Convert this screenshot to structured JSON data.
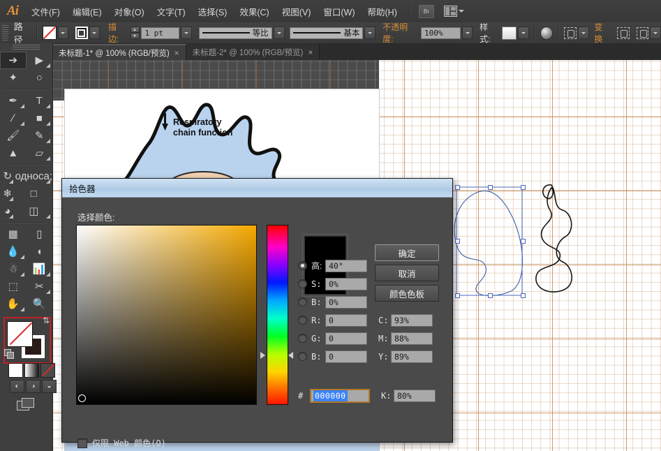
{
  "app": {
    "name": "Ai",
    "logo_color": "#e8913a"
  },
  "menubar": {
    "items": [
      "文件(F)",
      "编辑(E)",
      "对象(O)",
      "文字(T)",
      "选择(S)",
      "效果(C)",
      "视图(V)",
      "窗口(W)",
      "帮助(H)"
    ],
    "bridge_label": "Br"
  },
  "controlbar": {
    "object_label": "路径",
    "stroke_label": "描边:",
    "stroke_weight": "1 pt",
    "profile_label": "等比",
    "brush_label": "基本",
    "opacity_label": "不透明度:",
    "opacity_value": "100%",
    "style_label": "样式:",
    "transform_label": "变换"
  },
  "tabs": [
    {
      "title": "未标题-1* @ 100% (RGB/预览)",
      "close": "×",
      "active": true
    },
    {
      "title": "未标题-2* @ 100% (RGB/预览)",
      "close": "×",
      "active": false
    }
  ],
  "toolbar": {
    "tools": [
      "selection-tool",
      "direct-selection-tool",
      "magic-wand-tool",
      "lasso-tool",
      "pen-tool",
      "type-tool",
      "line-segment-tool",
      "rectangle-tool",
      "paintbrush-tool",
      "pencil-tool",
      "blob-brush-tool",
      "eraser-tool",
      "rotate-tool",
      "scale-tool",
      "width-tool",
      "free-transform-tool",
      "shape-builder-tool",
      "perspective-grid-tool",
      "mesh-tool",
      "gradient-tool",
      "eyedropper-tool",
      "blend-tool",
      "symbol-sprayer-tool",
      "column-graph-tool",
      "artboard-tool",
      "slice-tool",
      "hand-tool",
      "zoom-tool"
    ],
    "fill_state": "none",
    "stroke_state": "dark",
    "fill_modes": [
      "color-mode",
      "gradient-mode",
      "none-mode"
    ],
    "screen_modes": [
      "normal-screen-mode",
      "full-screen-menubar-mode",
      "full-screen-mode"
    ]
  },
  "artwork": {
    "caption_line1": "Respiratory",
    "caption_line2": "chain function"
  },
  "picker": {
    "title": "拾色器",
    "section_label": "选择颜色:",
    "buttons": {
      "ok": "确定",
      "cancel": "取消",
      "swatches": "颜色色板"
    },
    "hsb": [
      {
        "key": "高:",
        "value": "40°",
        "selected": true
      },
      {
        "key": "S:",
        "value": "0%",
        "selected": false
      },
      {
        "key": "B:",
        "value": "0%",
        "selected": false
      }
    ],
    "rgb": [
      {
        "key": "R:",
        "value": "0",
        "selected": false
      },
      {
        "key": "G:",
        "value": "0",
        "selected": false
      },
      {
        "key": "B:",
        "value": "0",
        "selected": false
      }
    ],
    "cmyk": [
      {
        "key": "C:",
        "value": "93%"
      },
      {
        "key": "M:",
        "value": "88%"
      },
      {
        "key": "Y:",
        "value": "89%"
      },
      {
        "key": "K:",
        "value": "80%"
      }
    ],
    "hex": {
      "hash": "#",
      "value": "000000"
    },
    "web_only_label": "仅限 Web 颜色(O)",
    "preview_color": "#000000",
    "accent_hue_color": "#f5a800",
    "hex_focus_color": "#b07828"
  }
}
